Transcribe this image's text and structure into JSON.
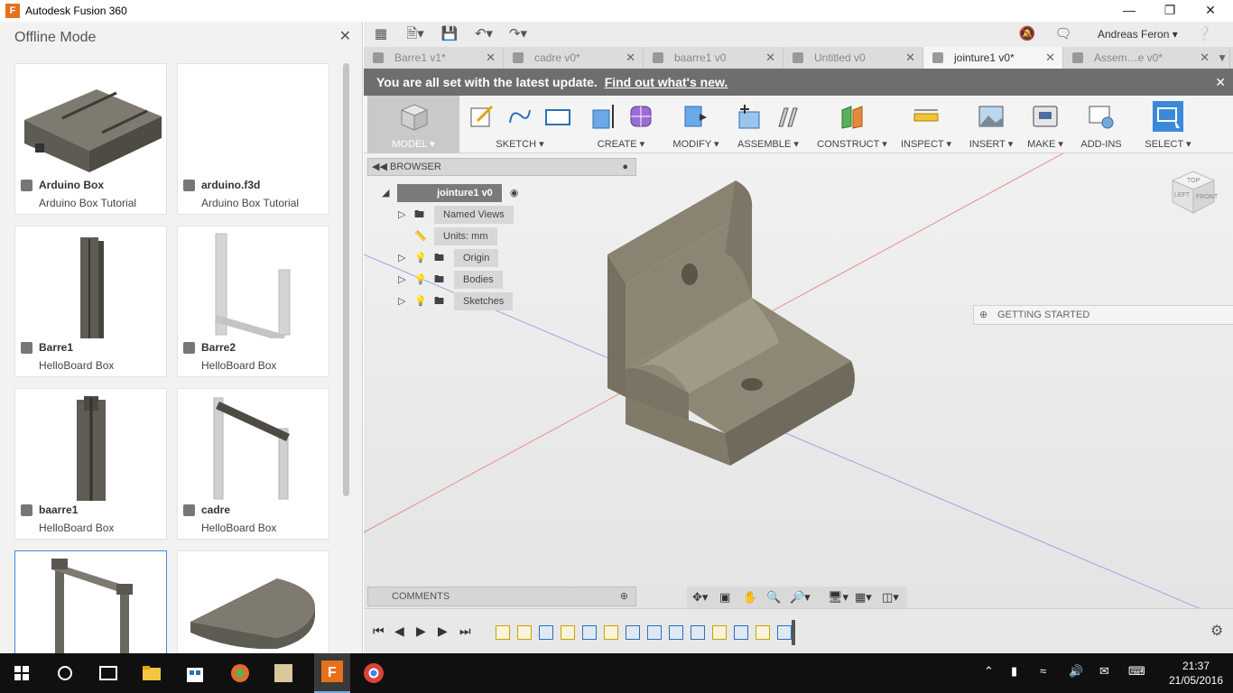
{
  "window": {
    "title": "Autodesk Fusion 360",
    "app_icon_letter": "F"
  },
  "data_panel": {
    "title": "Offline Mode",
    "items": [
      {
        "name": "Arduino Box",
        "project": "Arduino Box Tutorial"
      },
      {
        "name": "arduino.f3d",
        "project": "Arduino Box Tutorial"
      },
      {
        "name": "Barre1",
        "project": "HelloBoard Box"
      },
      {
        "name": "Barre2",
        "project": "HelloBoard Box"
      },
      {
        "name": "baarre1",
        "project": "HelloBoard Box"
      },
      {
        "name": "cadre",
        "project": "HelloBoard Box"
      },
      {
        "name": "",
        "project": ""
      },
      {
        "name": "",
        "project": ""
      }
    ]
  },
  "user": {
    "name": "Andreas Feron"
  },
  "tabs": [
    {
      "label": "Barre1 v1*"
    },
    {
      "label": "cadre v0*"
    },
    {
      "label": "baarre1 v0"
    },
    {
      "label": "Untitled v0"
    },
    {
      "label": "jointure1 v0*"
    },
    {
      "label": "Assem…e v0*"
    }
  ],
  "banner": {
    "text": "You are all set with the latest update.",
    "link": "Find out what's new."
  },
  "toolbar": {
    "groups": [
      {
        "label": "MODEL ▾"
      },
      {
        "label": "SKETCH ▾"
      },
      {
        "label": "CREATE ▾"
      },
      {
        "label": "MODIFY ▾"
      },
      {
        "label": "ASSEMBLE ▾"
      },
      {
        "label": "CONSTRUCT ▾"
      },
      {
        "label": "INSPECT ▾"
      },
      {
        "label": "INSERT ▾"
      },
      {
        "label": "MAKE ▾"
      },
      {
        "label": "ADD-INS"
      },
      {
        "label": "SELECT ▾"
      }
    ]
  },
  "browser": {
    "title": "BROWSER",
    "root": "jointure1 v0",
    "nodes": [
      {
        "label": "Named Views"
      },
      {
        "label": "Units: mm"
      },
      {
        "label": "Origin"
      },
      {
        "label": "Bodies"
      },
      {
        "label": "Sketches"
      }
    ]
  },
  "getting_started": {
    "label": "GETTING STARTED"
  },
  "comments": {
    "label": "COMMENTS"
  },
  "viewcube": {
    "top": "TOP",
    "left": "LEFT",
    "front": "FRONT"
  },
  "clock": {
    "time": "21:37",
    "date": "21/05/2016"
  },
  "colors": {
    "accent_blue": "#3b8ad9",
    "banner_bg": "#6e6e6e",
    "part_color": "#8c8573",
    "taskbar": "#101010"
  }
}
